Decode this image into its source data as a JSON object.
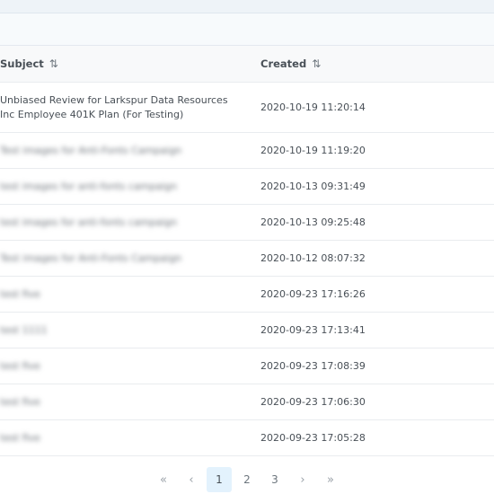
{
  "table": {
    "columns": [
      {
        "label": "Subject",
        "sort_glyph": "⇅"
      },
      {
        "label": "Created",
        "sort_glyph": "⇅"
      }
    ],
    "rows": [
      {
        "subject": "Unbiased Review for Larkspur Data Resources Inc Employee 401K Plan (For Testing)",
        "created": "2020-10-19 11:20:14",
        "blurred": false
      },
      {
        "subject": "Test images for Anti-Fonts Campaign",
        "created": "2020-10-19 11:19:20",
        "blurred": true
      },
      {
        "subject": "test images for anti-fonts campaign",
        "created": "2020-10-13 09:31:49",
        "blurred": true
      },
      {
        "subject": "test images for anti-fonts campaign",
        "created": "2020-10-13 09:25:48",
        "blurred": true
      },
      {
        "subject": "Test images for Anti-Fonts Campaign",
        "created": "2020-10-12 08:07:32",
        "blurred": true
      },
      {
        "subject": "test five",
        "created": "2020-09-23 17:16:26",
        "blurred": true
      },
      {
        "subject": "test 1111",
        "created": "2020-09-23 17:13:41",
        "blurred": true
      },
      {
        "subject": "test five",
        "created": "2020-09-23 17:08:39",
        "blurred": true
      },
      {
        "subject": "test five",
        "created": "2020-09-23 17:06:30",
        "blurred": true
      },
      {
        "subject": "test five",
        "created": "2020-09-23 17:05:28",
        "blurred": true
      }
    ]
  },
  "pagination": {
    "first": "«",
    "prev": "‹",
    "pages": [
      "1",
      "2",
      "3"
    ],
    "current": "1",
    "next": "›",
    "last": "»"
  },
  "colors": {
    "active_page_bg": "#e3f2fd",
    "header_bg": "#f8f9fa",
    "border": "#e9ecef"
  }
}
